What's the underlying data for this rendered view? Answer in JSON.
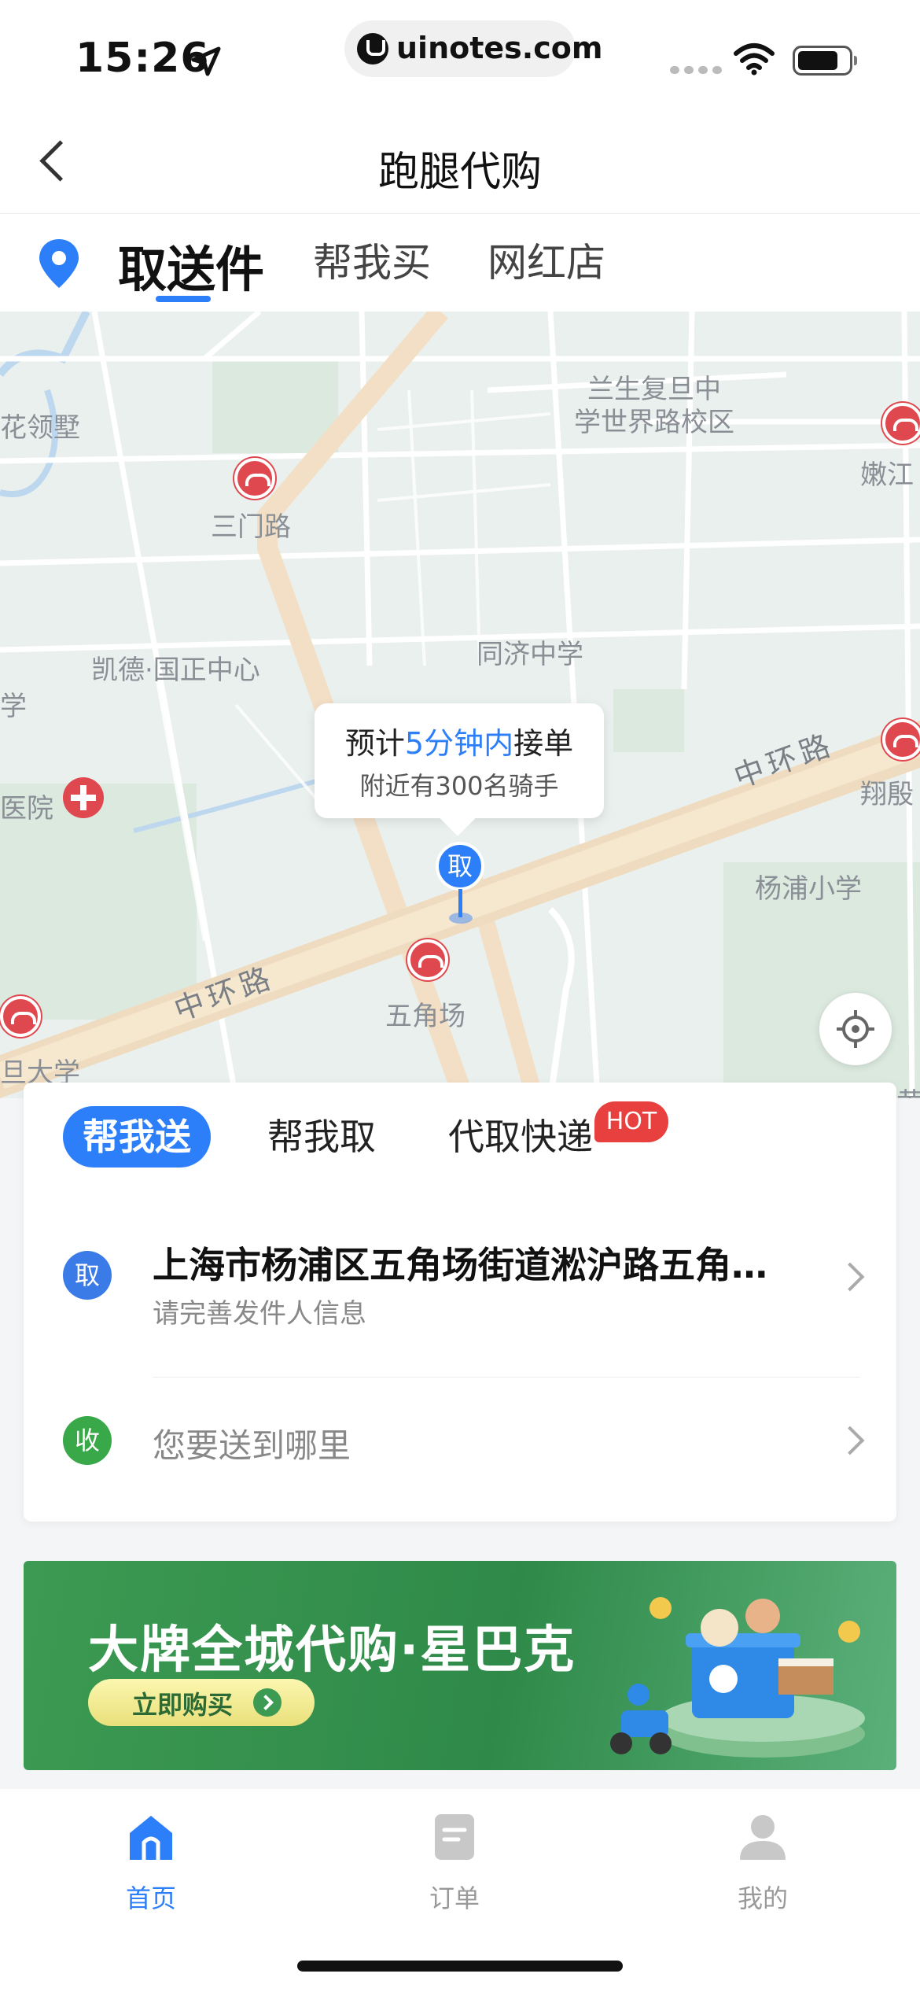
{
  "status_bar": {
    "time": "15:26",
    "url": "uinotes.com"
  },
  "nav": {
    "title": "跑腿代购"
  },
  "category_tabs": [
    {
      "label": "取送件",
      "active": true
    },
    {
      "label": "帮我买",
      "active": false
    },
    {
      "label": "网红店",
      "active": false
    }
  ],
  "map": {
    "labels": {
      "lansheng": "兰生复旦中\n学世界路校区",
      "nenjiang": "嫩江",
      "lingshu": "花领墅",
      "sanmenlu": "三门路",
      "kaide": "凯德·国正中心",
      "tongji": "同济中学",
      "xue": "学",
      "hospital": "医院",
      "xiangyin": "翔殷",
      "zhonghuan_right": "中环路",
      "zhonghuan_left": "中环路",
      "yangpu_school": "杨浦小学",
      "wujiaochang": "五角场",
      "daxue": "旦大学",
      "huang": "黄兴"
    },
    "tooltip": {
      "prefix": "预计",
      "highlight": "5分钟内",
      "suffix": "接单",
      "line2": "附近有300名骑手"
    },
    "pin_label": "取"
  },
  "service_tabs": [
    {
      "label": "帮我送",
      "active": true
    },
    {
      "label": "帮我取",
      "active": false
    },
    {
      "label": "代取快递",
      "active": false
    }
  ],
  "hot_badge": "HOT",
  "pickup": {
    "badge": "取",
    "address": "上海市杨浦区五角场街道淞沪路五角…",
    "hint": "请完善发件人信息"
  },
  "delivery": {
    "badge": "收",
    "placeholder": "您要送到哪里"
  },
  "banner": {
    "title": "大牌全城代购·星巴克",
    "button": "立即购买"
  },
  "tabbar": [
    {
      "label": "首页",
      "active": true
    },
    {
      "label": "订单",
      "active": false
    },
    {
      "label": "我的",
      "active": false
    }
  ],
  "colors": {
    "accent": "#2d7ff9",
    "pickup_badge": "#3b7be8",
    "delivery_badge": "#39a849",
    "hot": "#e8403f"
  }
}
